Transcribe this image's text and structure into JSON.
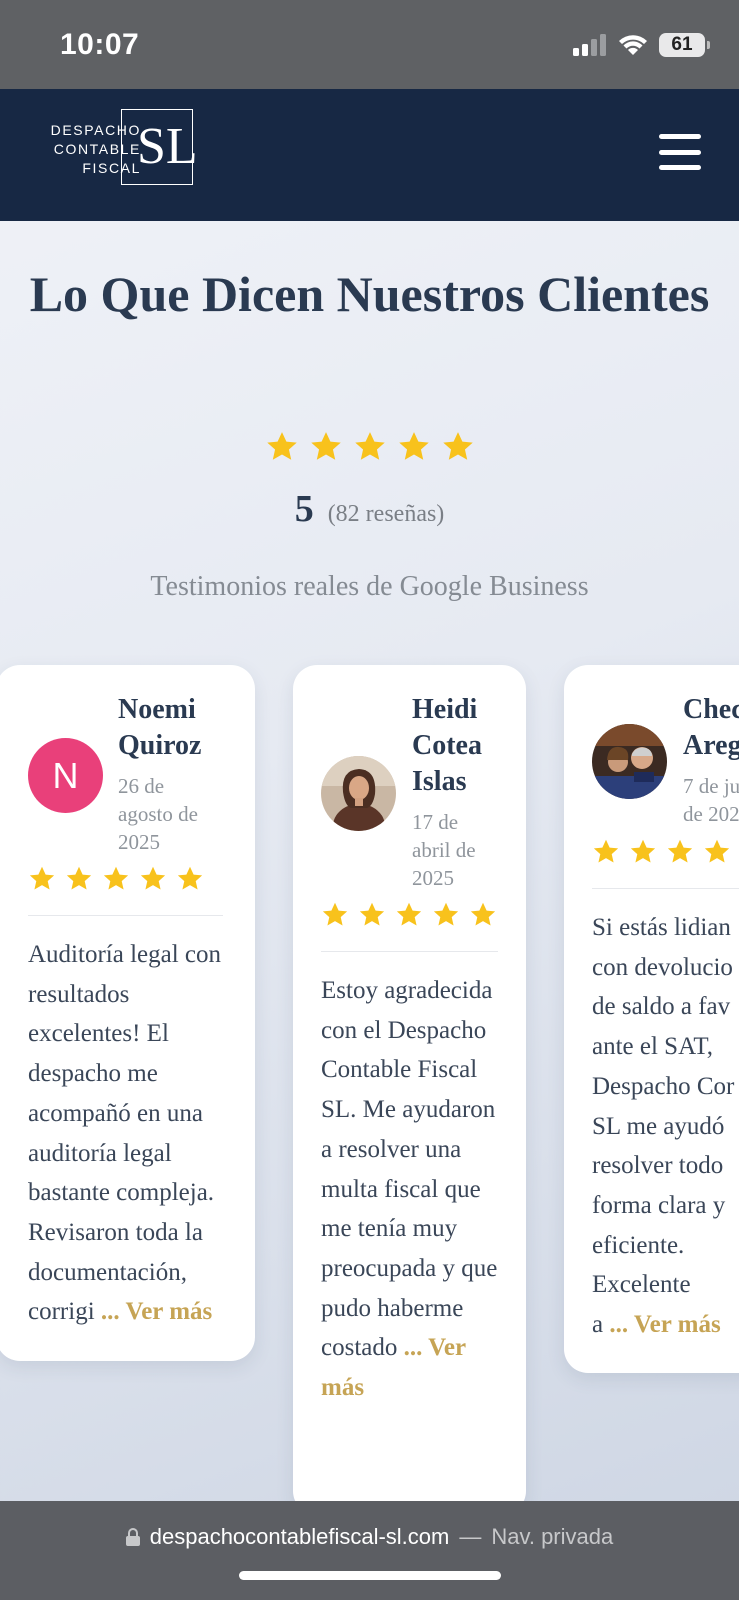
{
  "status_bar": {
    "time": "10:07",
    "battery": "61"
  },
  "header": {
    "logo": {
      "line1": "DESPACHO",
      "line2": "CONTABLE",
      "line3": "FISCAL",
      "monogram": "SL"
    },
    "menu_icon": "hamburger-menu-icon"
  },
  "hero": {
    "title": "Lo Que Dicen Nuestros Clientes",
    "rating_value": "5",
    "rating_stars": 5,
    "rating_count": "(82 reseñas)",
    "subtitle": "Testimonios reales de Google Business"
  },
  "reviews": [
    {
      "name_line1": "Noemi",
      "name_line2": "Quiroz",
      "date_line1": "26 de",
      "date_line2": "agosto de",
      "date_line3": "2025",
      "avatar_initial": "N",
      "avatar_color": "#e9407a",
      "stars": 5,
      "text": "Auditoría legal con resultados excelentes! El despacho me acompañó en una auditoría legal bastante compleja. Revisaron toda la documentación, corrigi",
      "read_more": "... Ver más"
    },
    {
      "name_line1": "Heidi",
      "name_line2": "Cotea",
      "name_line3": "Islas",
      "date_line1": "17 de",
      "date_line2": "abril de",
      "date_line3": "2025",
      "avatar_icon": "woman-photo-avatar",
      "stars": 5,
      "text": "Estoy agradecida con el Despacho Contable Fiscal SL. Me ayudaron a resolver una multa fiscal que me tenía muy preocupada y que pudo haberme costado",
      "read_more": "... Ver más"
    },
    {
      "name_line1": "Chec",
      "name_line2": "Areg",
      "date_line1": "7 de ju",
      "date_line2": "de 202",
      "avatar_icon": "couple-photo-avatar",
      "stars": 5,
      "text": "Si estás lidian con devolucio de saldo a fav ante el SAT, Despacho Cor SL me ayudó resolver todo forma clara y eficiente. Excelente a",
      "read_more": "... Ver más"
    }
  ],
  "browser_bar": {
    "lock_icon": "lock-icon",
    "url": "despachocontablefiscal-sl.com",
    "separator": "—",
    "mode": "Nav. privada"
  },
  "colors": {
    "navy": "#172844",
    "star": "#f8c21c",
    "accent_gold": "#c6a455",
    "title": "#2a3a51"
  }
}
